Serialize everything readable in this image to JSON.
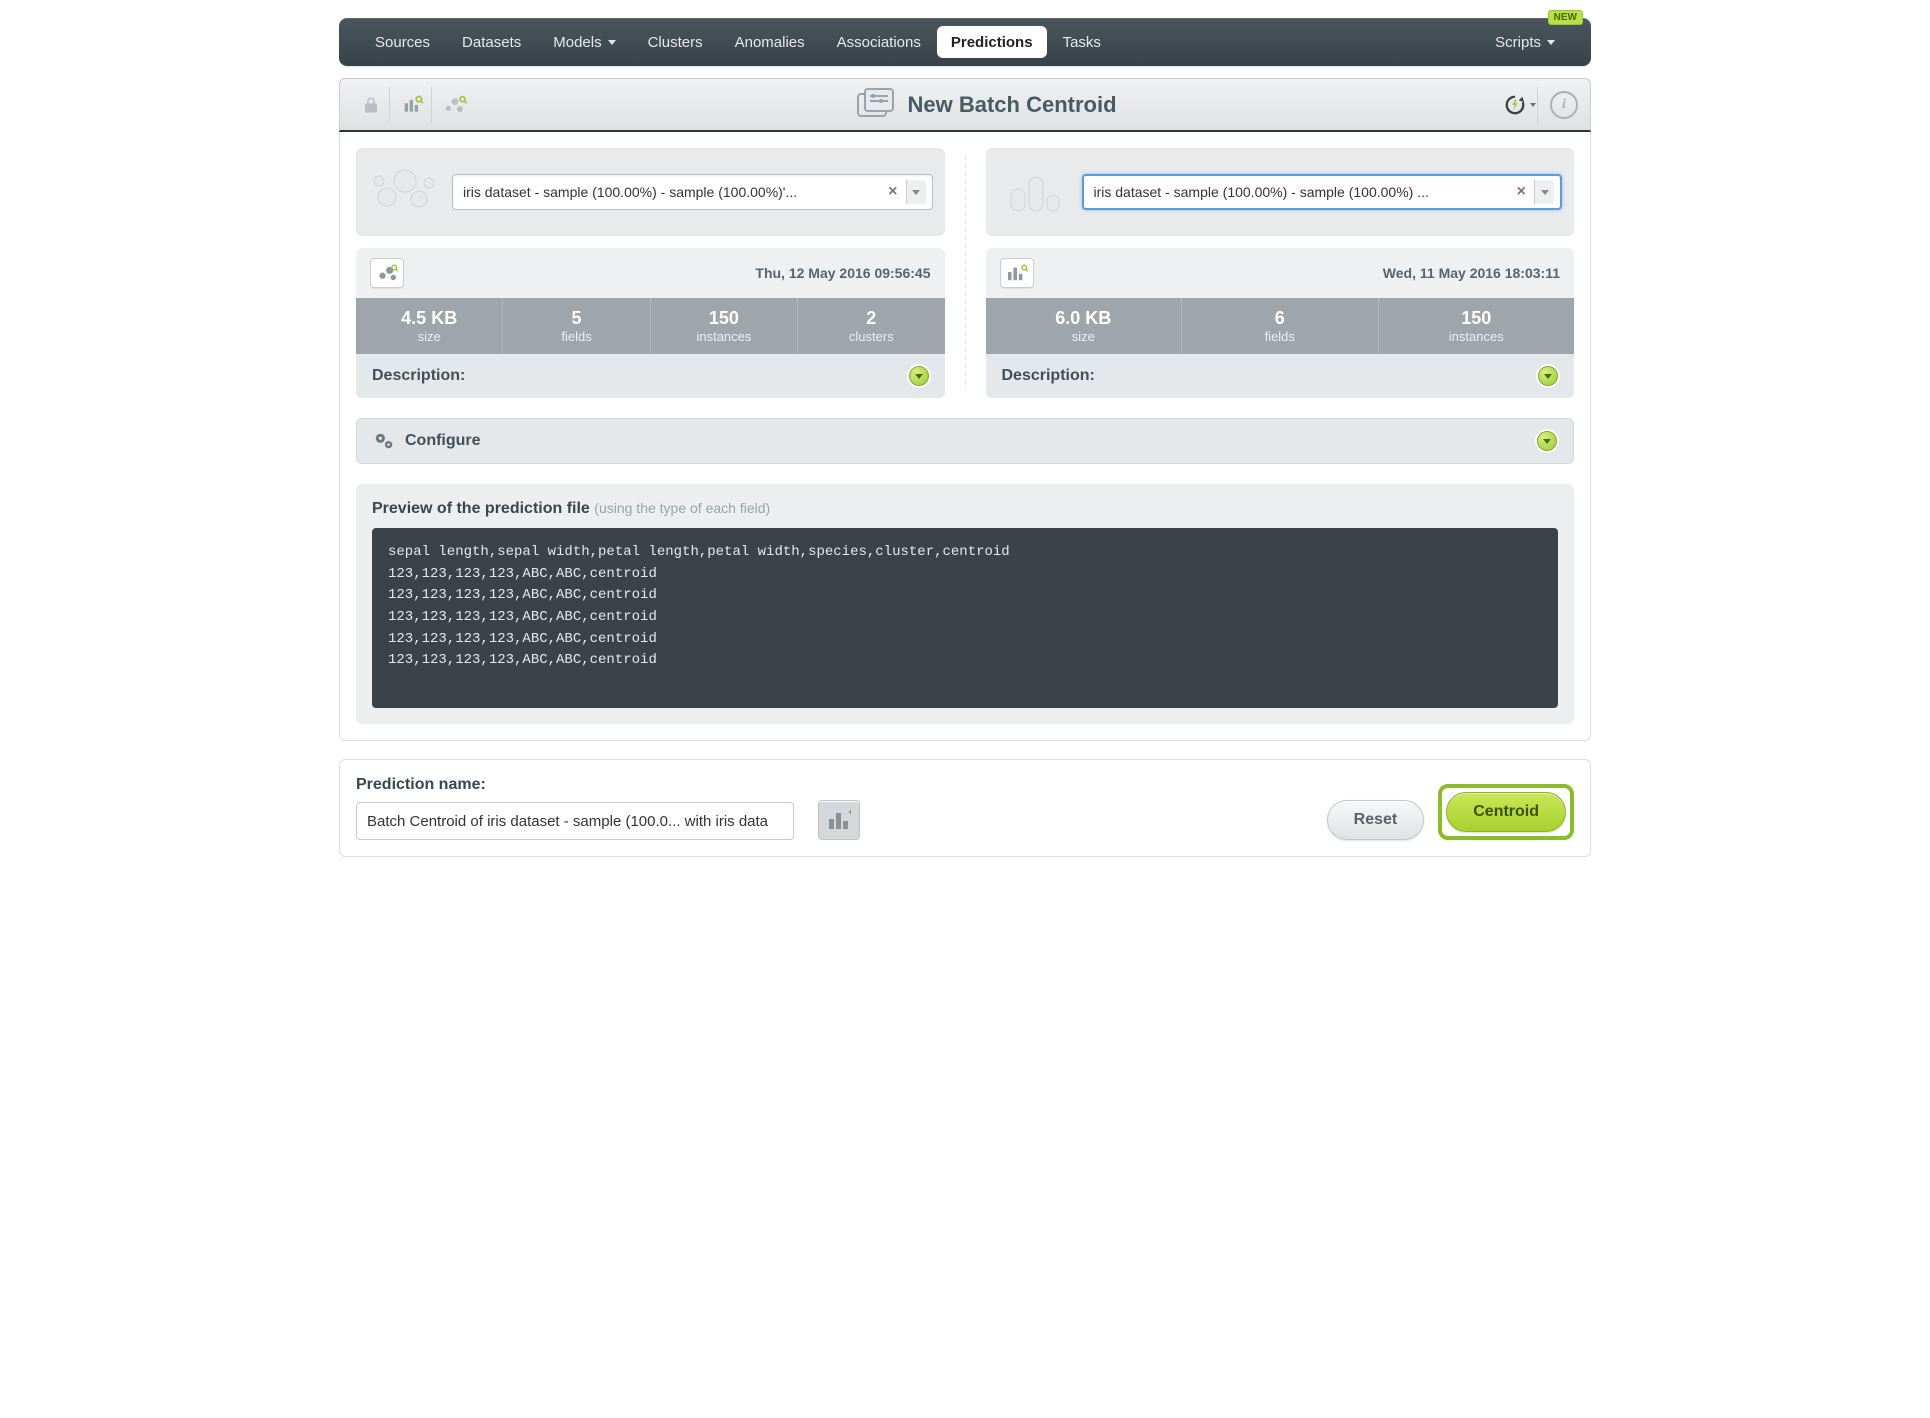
{
  "nav": {
    "items": [
      "Sources",
      "Datasets",
      "Models",
      "Clusters",
      "Anomalies",
      "Associations",
      "Predictions",
      "Tasks"
    ],
    "models_has_caret": true,
    "active_index": 6,
    "scripts_label": "Scripts",
    "new_badge": "NEW"
  },
  "header": {
    "title": "New Batch Centroid"
  },
  "left": {
    "selector_text": "iris dataset - sample (100.00%) - sample (100.00%)'...",
    "timestamp": "Thu, 12 May 2016 09:56:45",
    "stats": [
      {
        "value": "4.5 KB",
        "label": "size"
      },
      {
        "value": "5",
        "label": "fields"
      },
      {
        "value": "150",
        "label": "instances"
      },
      {
        "value": "2",
        "label": "clusters"
      }
    ],
    "description_label": "Description:"
  },
  "right": {
    "selector_text": "iris dataset - sample (100.00%) - sample (100.00%) ...",
    "timestamp": "Wed, 11 May 2016 18:03:11",
    "stats": [
      {
        "value": "6.0 KB",
        "label": "size"
      },
      {
        "value": "6",
        "label": "fields"
      },
      {
        "value": "150",
        "label": "instances"
      }
    ],
    "description_label": "Description:"
  },
  "configure_label": "Configure",
  "preview": {
    "title": "Preview of the prediction file",
    "hint": "(using the type of each field)",
    "lines": [
      "sepal length,sepal width,petal length,petal width,species,cluster,centroid",
      "123,123,123,123,ABC,ABC,centroid",
      "123,123,123,123,ABC,ABC,centroid",
      "123,123,123,123,ABC,ABC,centroid",
      "123,123,123,123,ABC,ABC,centroid",
      "123,123,123,123,ABC,ABC,centroid"
    ]
  },
  "footer": {
    "name_label": "Prediction name:",
    "name_value": "Batch Centroid of iris dataset - sample (100.0... with iris data",
    "reset_label": "Reset",
    "submit_label": "Centroid"
  }
}
